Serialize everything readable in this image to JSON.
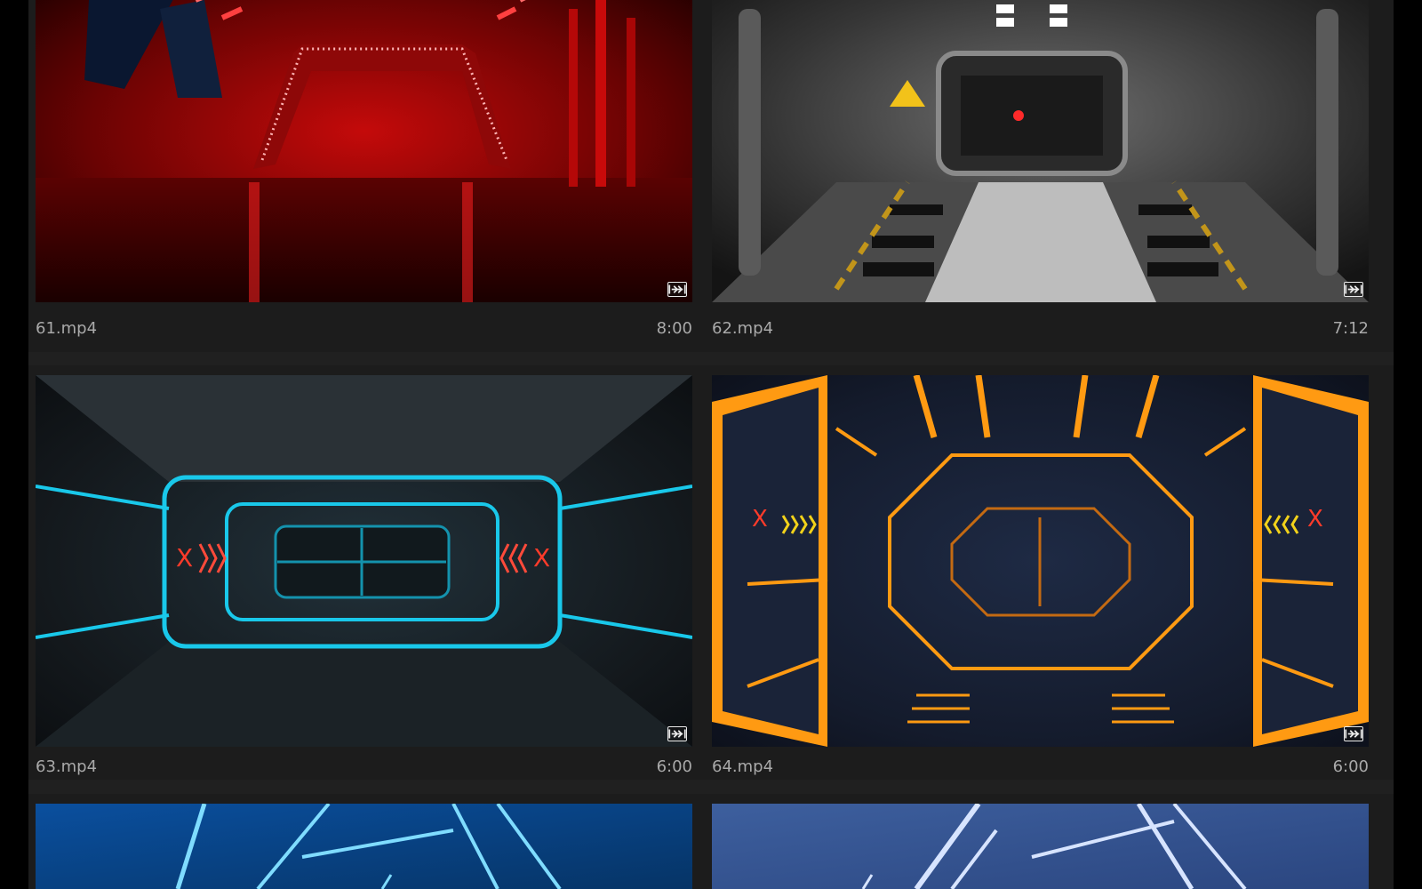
{
  "clips": [
    {
      "filename": "61.mp4",
      "duration": "8:00",
      "theme": "red-neon-corridor",
      "accent": "#e50c0c"
    },
    {
      "filename": "62.mp4",
      "duration": "7:12",
      "theme": "grey-industrial-corridor",
      "accent": "#d9a21a"
    },
    {
      "filename": "63.mp4",
      "duration": "6:00",
      "theme": "cyan-neon-corridor",
      "accent": "#19c8ea"
    },
    {
      "filename": "64.mp4",
      "duration": "6:00",
      "theme": "orange-hexagon-corridor",
      "accent": "#ff9a12"
    },
    {
      "filename": "",
      "duration": "",
      "theme": "blue-neon-lines",
      "accent": "#1aa8f0"
    },
    {
      "filename": "",
      "duration": "",
      "theme": "pale-blue-lines",
      "accent": "#a9c2ef"
    }
  ],
  "badge_icon": "multicam-clip-icon"
}
